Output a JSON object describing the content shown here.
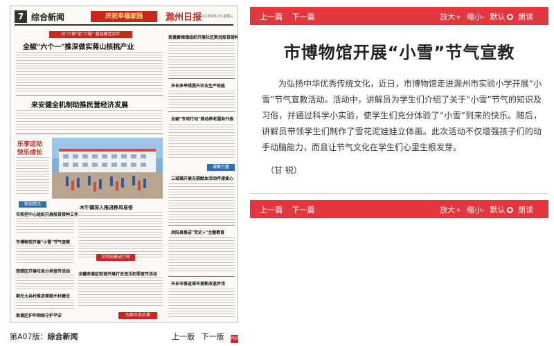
{
  "paper_thumb": {
    "page_number": "7",
    "section": "综合新闻",
    "ad_text": "庆祝幸福家园",
    "masthead": "滁州日报",
    "date_line": "2021年6月2日 星期三",
    "headlines": [
      {
        "text": "扶\"六保\"促\"六稳\"  喜迎建党百年",
        "style": "redbar"
      },
      {
        "text": "全椒\"六个一\"推深做实蒋山核桃产业",
        "style": "big"
      },
      {
        "text": "来安健全机制助推民营经济发展",
        "style": "big"
      },
      {
        "text": "乐享运动",
        "style": "red"
      },
      {
        "text": "快乐成长",
        "style": "red"
      },
      {
        "text": "新闻简讯",
        "style": "bluebar"
      },
      {
        "text": "市疾控中心组织开展疫苗接种工作",
        "style": "small"
      },
      {
        "text": "市博物馆开展\"小雪\"节气宣教",
        "style": "small"
      },
      {
        "text": "琅琊区开展垃圾分类宣传活动",
        "style": "small"
      },
      {
        "text": "明光大井村推进美丽乡村建设",
        "style": "small"
      },
      {
        "text": "南谯区护牢网格守护平安",
        "style": "small"
      },
      {
        "text": "木牛镇深入推进移风易俗",
        "style": "mid"
      },
      {
        "text": "龙蟠南谯区街道开展打击违法犯罪宣传活动",
        "style": "mid"
      },
      {
        "text": "南谯黄梅镇组织开展社区新冠疫苗接种",
        "style": "mid"
      },
      {
        "text": "天长多举措提升农业生产效能",
        "style": "mid"
      },
      {
        "text": "全椒\"专项行动\"推动养老服务升级",
        "style": "mid"
      },
      {
        "text": "三城镇开展无偿献血活动传递爱心",
        "style": "mid"
      },
      {
        "text": "凤阳县推进\"党史+\"主题教育",
        "style": "mid"
      },
      {
        "text": "天长市推进城市更新改造步伐",
        "style": "mid"
      }
    ],
    "badges": [
      "文明创建进行时",
      "凝聚力量",
      "为群众办实事"
    ]
  },
  "left_footer": {
    "edition_label": "第A07版：",
    "edition_name": "综合新闻",
    "prev_page": "上一版",
    "next_page": "下一版",
    "pdf_icon": "pdf-icon"
  },
  "toolbar": {
    "prev": "上一篇",
    "next": "下一篇",
    "zoom_in": "放大+",
    "zoom_out": "缩小-",
    "default": "默认",
    "read_aloud": "朗读"
  },
  "article": {
    "title": "市博物馆开展“小雪”节气宣教",
    "body": "为弘扬中华优秀传统文化，近日，市博物馆走进滁州市实验小学开展“小雪”节气宣教活动。活动中，讲解员为学生们介绍了关于“小雪”节气的知识及习俗，并通过科学小实验，使学生们充分体验了“小雪”到来的快乐。随后，讲解员带领学生们制作了雪花泥娃娃立体画。此次活动不仅增强孩子们的动手动脑能力，而且让节气文化在学生们心里生根发芽。",
    "author": "（甘  锐）"
  },
  "colors": {
    "toolbar_red": "#e3373d",
    "paper_red": "#c8261e"
  }
}
